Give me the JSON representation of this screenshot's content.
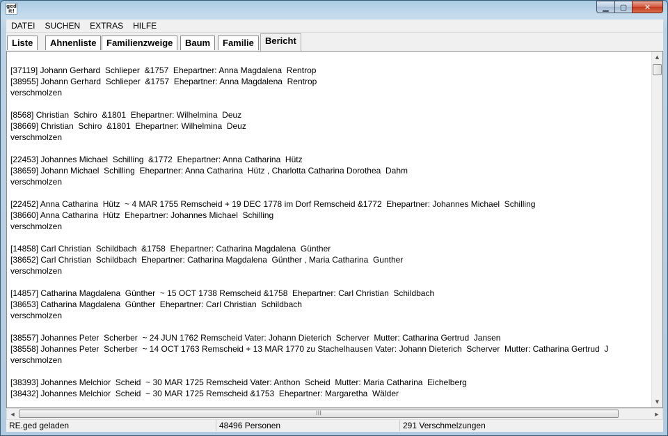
{
  "app": {
    "icon_text_line1": "ged",
    "icon_text_line2": "it!"
  },
  "window_controls": {
    "minimize": "▁",
    "maximize": "▢",
    "close": "✕"
  },
  "menu": [
    "DATEI",
    "SUCHEN",
    "EXTRAS",
    "HILFE"
  ],
  "tabs": [
    {
      "label": "Liste",
      "active": false
    },
    {
      "label": "Ahnenliste",
      "active": false
    },
    {
      "label": "Familienzweige",
      "active": false
    },
    {
      "label": "Baum",
      "active": false
    },
    {
      "label": "Familie",
      "active": false
    },
    {
      "label": "Bericht",
      "active": true
    }
  ],
  "report": {
    "lines": [
      "[37119] Johann Gerhard  Schlieper  &1757  Ehepartner: Anna Magdalena  Rentrop",
      "[38955] Johann Gerhard  Schlieper  &1757  Ehepartner: Anna Magdalena  Rentrop",
      "verschmolzen",
      "",
      "[8568] Christian  Schiro  &1801  Ehepartner: Wilhelmina  Deuz",
      "[38669] Christian  Schiro  &1801  Ehepartner: Wilhelmina  Deuz",
      "verschmolzen",
      "",
      "[22453] Johannes Michael  Schilling  &1772  Ehepartner: Anna Catharina  Hütz",
      "[38659] Johann Michael  Schilling  Ehepartner: Anna Catharina  Hütz , Charlotta Catharina Dorothea  Dahm",
      "verschmolzen",
      "",
      "[22452] Anna Catharina  Hütz  ~ 4 MAR 1755 Remscheid + 19 DEC 1778 im Dorf Remscheid &1772  Ehepartner: Johannes Michael  Schilling",
      "[38660] Anna Catharina  Hütz  Ehepartner: Johannes Michael  Schilling",
      "verschmolzen",
      "",
      "[14858] Carl Christian  Schildbach  &1758  Ehepartner: Catharina Magdalena  Günther",
      "[38652] Carl Christian  Schildbach  Ehepartner: Catharina Magdalena  Günther , Maria Catharina  Gunther",
      "verschmolzen",
      "",
      "[14857] Catharina Magdalena  Günther  ~ 15 OCT 1738 Remscheid &1758  Ehepartner: Carl Christian  Schildbach",
      "[38653] Catharina Magdalena  Günther  Ehepartner: Carl Christian  Schildbach",
      "verschmolzen",
      "",
      "[38557] Johannes Peter  Scherber  ~ 24 JUN 1762 Remscheid Vater: Johann Dieterich  Scherver  Mutter: Catharina Gertrud  Jansen",
      "[38558] Johannes Peter  Scherber  ~ 14 OCT 1763 Remscheid + 13 MAR 1770 zu Stachelhausen Vater: Johann Dieterich  Scherver  Mutter: Catharina Gertrud  J",
      "verschmolzen",
      "",
      "[38393] Johannes Melchior  Scheid  ~ 30 MAR 1725 Remscheid Vater: Anthon  Scheid  Mutter: Maria Catharina  Eichelberg",
      "[38432] Johannes Melchior  Scheid  ~ 30 MAR 1725 Remscheid &1753  Ehepartner: Margaretha  Wälder"
    ]
  },
  "scroll": {
    "up": "▲",
    "down": "▼",
    "left": "◀",
    "right": "▶",
    "grip": "III"
  },
  "status": {
    "file": "RE.ged geladen",
    "persons": "48496 Personen",
    "merges": "291 Verschmelzungen"
  }
}
